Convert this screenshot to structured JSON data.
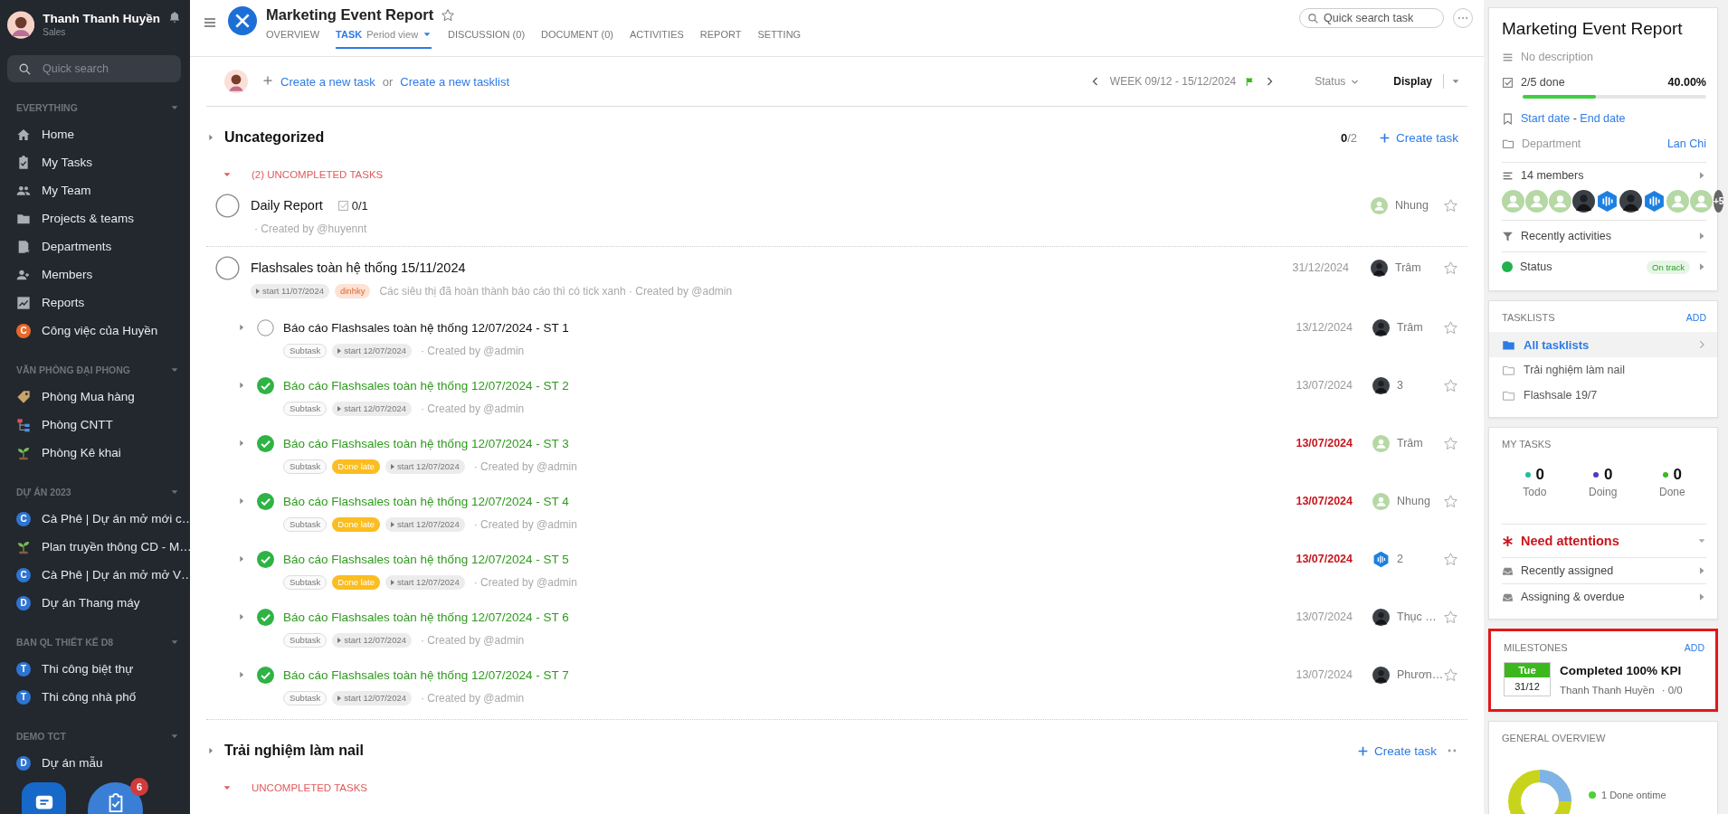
{
  "sidebar": {
    "user": {
      "name": "Thanh Thanh Huyền",
      "role": "Sales"
    },
    "search": {
      "placeholder": "Quick search"
    },
    "sections": [
      {
        "title": "EVERYTHING",
        "items": [
          {
            "label": "Home",
            "kind": "home"
          },
          {
            "label": "My Tasks",
            "kind": "tasks"
          },
          {
            "label": "My Team",
            "kind": "team"
          },
          {
            "label": "Projects & teams",
            "kind": "folder"
          },
          {
            "label": "Departments",
            "kind": "department"
          },
          {
            "label": "Members",
            "kind": "members"
          },
          {
            "label": "Reports",
            "kind": "reports"
          },
          {
            "label": "Công việc của Huyền",
            "kind": "letter",
            "letter": "C",
            "color": "#e8682a"
          }
        ]
      },
      {
        "title": "VĂN PHÒNG ĐẠI PHONG",
        "items": [
          {
            "label": "Phòng Mua hàng",
            "kind": "tag"
          },
          {
            "label": "Phòng CNTT",
            "kind": "org"
          },
          {
            "label": "Phòng Kê khai",
            "kind": "plant"
          }
        ]
      },
      {
        "title": "DỰ ÁN 2023",
        "items": [
          {
            "label": "Cà Phê | Dự án mở mới c…",
            "kind": "letter",
            "letter": "C",
            "color": "#2f74d0"
          },
          {
            "label": "Plan truyền thông CD - M…",
            "kind": "plant"
          },
          {
            "label": "Cà Phê | Dự án mở mở V…",
            "kind": "letter",
            "letter": "C",
            "color": "#2f74d0"
          },
          {
            "label": "Dự án Thang máy",
            "kind": "letter",
            "letter": "D",
            "color": "#2f74d0"
          }
        ]
      },
      {
        "title": "BAN QL THIẾT KẾ D8",
        "items": [
          {
            "label": "Thi công biệt thự",
            "kind": "letter",
            "letter": "T",
            "color": "#2f74d0"
          },
          {
            "label": "Thi công nhà phố",
            "kind": "letter",
            "letter": "T",
            "color": "#2f74d0"
          }
        ]
      },
      {
        "title": "DEMO TCT",
        "items": [
          {
            "label": "Dự án mẫu",
            "kind": "letter",
            "letter": "D",
            "color": "#2f74d0"
          }
        ]
      }
    ],
    "fab_badge": "6"
  },
  "header": {
    "title": "Marketing Event Report",
    "search": {
      "placeholder": "Quick search task"
    },
    "tabs": [
      {
        "label": "OVERVIEW",
        "selected": false
      },
      {
        "label": "TASK",
        "view": "Period view",
        "selected": true
      },
      {
        "label": "DISCUSSION (0)",
        "selected": false
      },
      {
        "label": "DOCUMENT (0)",
        "selected": false
      },
      {
        "label": "ACTIVITIES",
        "selected": false
      },
      {
        "label": "REPORT",
        "selected": false
      },
      {
        "label": "SETTING",
        "selected": false
      }
    ]
  },
  "toolbar": {
    "create_task": "Create a new task",
    "or": "or",
    "create_tasklist": "Create a new tasklist",
    "week": "WEEK 09/12 - 15/12/2024",
    "status": "Status",
    "display": "Display"
  },
  "tasklists": [
    {
      "name": "Uncategorized",
      "count": "**0**/2",
      "create": "Create task",
      "more": false,
      "groups": [
        {
          "label": "(2) UNCOMPLETED TASKS",
          "expanded": true,
          "tasks": [
            {
              "title": "Daily Report",
              "done": false,
              "checklist": "0/1",
              "note": "· Created by @huyennt",
              "assignee": {
                "name": "Nhung",
                "kind": "user"
              }
            },
            {
              "title": "Flashsales toàn hệ thống 15/11/2024",
              "done": false,
              "tags": [
                {
                  "kind": "start",
                  "text": "start 11/07/2024"
                },
                {
                  "kind": "label",
                  "text": "dinhky"
                }
              ],
              "note": "Các siêu thị đã hoàn thành báo cáo thì có tick xanh · Created by @admin",
              "due": "31/12/2024",
              "overdue": false,
              "assignee": {
                "name": "Trâm",
                "kind": "photo"
              },
              "children": [
                {
                  "title": "Báo cáo Flashsales toàn hệ thống 12/07/2024 - ST 1",
                  "done": false,
                  "tags": [
                    {
                      "kind": "subtask",
                      "text": "Subtask"
                    },
                    {
                      "kind": "start",
                      "text": "start 12/07/2024"
                    }
                  ],
                  "note": "· Created by @admin",
                  "due": "13/12/2024",
                  "overdue": false,
                  "assignee": {
                    "name": "Trâm",
                    "kind": "photo"
                  }
                },
                {
                  "title": "Báo cáo Flashsales toàn hệ thống 12/07/2024 - ST 2",
                  "done": true,
                  "tags": [
                    {
                      "kind": "subtask",
                      "text": "Subtask"
                    },
                    {
                      "kind": "start",
                      "text": "start 12/07/2024"
                    }
                  ],
                  "note": "· Created by @admin",
                  "due": "13/07/2024",
                  "overdue": false,
                  "assignee": {
                    "name": "3",
                    "kind": "photo"
                  }
                },
                {
                  "title": "Báo cáo Flashsales toàn hệ thống 12/07/2024 - ST 3",
                  "done": true,
                  "tags": [
                    {
                      "kind": "subtask",
                      "text": "Subtask"
                    },
                    {
                      "kind": "late",
                      "text": "Done late"
                    },
                    {
                      "kind": "start",
                      "text": "start 12/07/2024"
                    }
                  ],
                  "note": "· Created by @admin",
                  "due": "13/07/2024",
                  "overdue": true,
                  "assignee": {
                    "name": "Trâm",
                    "kind": "user"
                  }
                },
                {
                  "title": "Báo cáo Flashsales toàn hệ thống 12/07/2024 - ST 4",
                  "done": true,
                  "tags": [
                    {
                      "kind": "subtask",
                      "text": "Subtask"
                    },
                    {
                      "kind": "late",
                      "text": "Done late"
                    },
                    {
                      "kind": "start",
                      "text": "start 12/07/2024"
                    }
                  ],
                  "note": "· Created by @admin",
                  "due": "13/07/2024",
                  "overdue": true,
                  "assignee": {
                    "name": "Nhung",
                    "kind": "user"
                  }
                },
                {
                  "title": "Báo cáo Flashsales toàn hệ thống 12/07/2024 - ST 5",
                  "done": true,
                  "tags": [
                    {
                      "kind": "subtask",
                      "text": "Subtask"
                    },
                    {
                      "kind": "late",
                      "text": "Done late"
                    },
                    {
                      "kind": "start",
                      "text": "start 12/07/2024"
                    }
                  ],
                  "note": "· Created by @admin",
                  "due": "13/07/2024",
                  "overdue": true,
                  "assignee": {
                    "name": "2",
                    "kind": "hex"
                  }
                },
                {
                  "title": "Báo cáo Flashsales toàn hệ thống 12/07/2024 - ST 6",
                  "done": true,
                  "tags": [
                    {
                      "kind": "subtask",
                      "text": "Subtask"
                    },
                    {
                      "kind": "start",
                      "text": "start 12/07/2024"
                    }
                  ],
                  "note": "· Created by @admin",
                  "due": "13/07/2024",
                  "overdue": false,
                  "assignee": {
                    "name": "Thục …",
                    "kind": "photo"
                  }
                },
                {
                  "title": "Báo cáo Flashsales toàn hệ thống 12/07/2024 - ST 7",
                  "done": true,
                  "tags": [
                    {
                      "kind": "subtask",
                      "text": "Subtask"
                    },
                    {
                      "kind": "start",
                      "text": "start 12/07/2024"
                    }
                  ],
                  "note": "· Created by @admin",
                  "due": "13/07/2024",
                  "overdue": false,
                  "assignee": {
                    "name": "Phươn…",
                    "kind": "photo"
                  }
                }
              ]
            }
          ]
        }
      ]
    },
    {
      "name": "Trải nghiệm làm nail",
      "create": "Create task",
      "more": true,
      "groups": [
        {
          "label": "UNCOMPLETED TASKS",
          "expanded": true
        }
      ]
    }
  ],
  "panel": {
    "project": {
      "title": "Marketing Event Report",
      "description": "No description",
      "done": "2/5 done",
      "percent": "40.00%",
      "level": 0.4,
      "start": "Start date",
      "dash": "-",
      "end": "End date",
      "department_label": "Department",
      "department": "Lan Chi",
      "members": "14 members",
      "avatars": [
        {
          "kind": "user"
        },
        {
          "kind": "user"
        },
        {
          "kind": "user"
        },
        {
          "kind": "photo"
        },
        {
          "kind": "hex"
        },
        {
          "kind": "photo"
        },
        {
          "kind": "hex"
        },
        {
          "kind": "user"
        },
        {
          "kind": "user"
        },
        {
          "kind": "more",
          "text": "+5"
        }
      ],
      "activities": "Recently activities",
      "status_label": "Status",
      "status": "On track"
    },
    "tasklists": {
      "title": "TASKLISTS",
      "add": "ADD",
      "items": [
        {
          "label": "All tasklists",
          "selected": true
        },
        {
          "label": "Trải nghiệm làm nail",
          "selected": false
        },
        {
          "label": "Flashsale 19/7",
          "selected": false
        }
      ]
    },
    "my_tasks": {
      "title": "MY TASKS",
      "stats": [
        {
          "value": "0",
          "label": "Todo",
          "color": "#1fbf9a"
        },
        {
          "value": "0",
          "label": "Doing",
          "color": "#4b3cbf"
        },
        {
          "value": "0",
          "label": "Done",
          "color": "#3cb81e"
        }
      ],
      "attention": "Need attentions",
      "links": [
        "Recently assigned",
        "Assigning & overdue"
      ]
    },
    "milestones": {
      "title": "MILESTONES",
      "add": "ADD",
      "highlighted": true,
      "items": [
        {
          "day": "Tue",
          "date": "31/12",
          "name": "Completed 100% KPI",
          "owner": "Thanh Thanh Huyền",
          "progress": "· 0/0"
        }
      ]
    },
    "overview": {
      "title": "GENERAL OVERVIEW",
      "legend": "1 Done ontime"
    }
  }
}
